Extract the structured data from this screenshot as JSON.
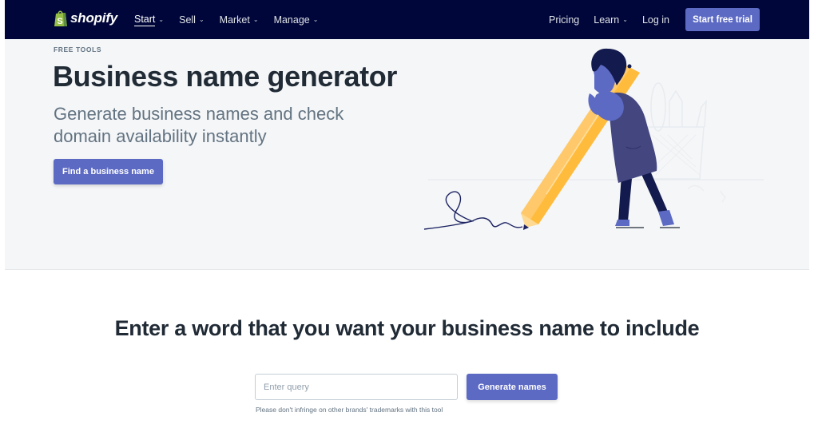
{
  "nav": {
    "logo_text": "shopify",
    "left_items": [
      {
        "label": "Start",
        "active": true,
        "has_dropdown": true
      },
      {
        "label": "Sell",
        "active": false,
        "has_dropdown": true
      },
      {
        "label": "Market",
        "active": false,
        "has_dropdown": true
      },
      {
        "label": "Manage",
        "active": false,
        "has_dropdown": true
      }
    ],
    "right_items": [
      {
        "label": "Pricing",
        "has_dropdown": false
      },
      {
        "label": "Learn",
        "has_dropdown": true
      },
      {
        "label": "Log in",
        "has_dropdown": false
      }
    ],
    "cta_label": "Start free trial",
    "dropdown_glyph": "⌄"
  },
  "hero": {
    "eyebrow": "FREE TOOLS",
    "title": "Business name generator",
    "subtitle": "Generate business names and check domain availability instantly",
    "button_label": "Find a business name",
    "illustration": "person-with-giant-pencil"
  },
  "form": {
    "title": "Enter a word that you want your business name to include",
    "input_value": "",
    "input_placeholder": "Enter query",
    "button_label": "Generate names",
    "disclaimer": "Please don't infringe on other brands' trademarks with this tool"
  },
  "colors": {
    "nav_bg": "#000639",
    "accent": "#5c6ac4",
    "hero_bg": "#f4f6f8",
    "logo_green": "#95bf47",
    "pencil_yellow": "#ffbb3c"
  }
}
